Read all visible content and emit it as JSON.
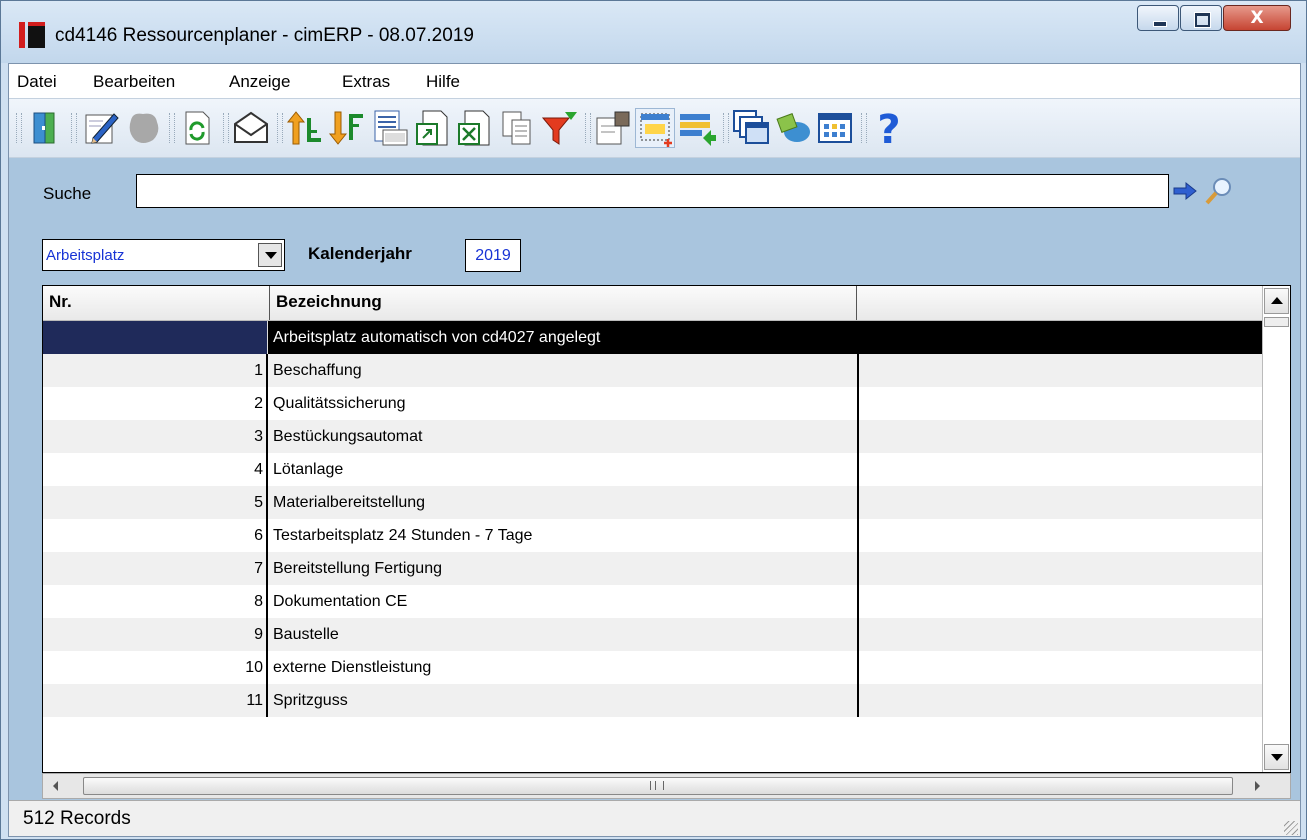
{
  "window": {
    "title": "cd4146 Ressourcenplaner - cimERP - 08.07.2019",
    "close_label": "X"
  },
  "menu": [
    "Datei",
    "Bearbeiten",
    "Anzeige",
    "Extras",
    "Hilfe"
  ],
  "toolbar": {
    "icons": [
      "exit-icon",
      "edit-icon",
      "delete-icon",
      "refresh-icon",
      "mail-icon",
      "sort-ascending-icon",
      "sort-descending-icon",
      "numbered-list-icon",
      "export-icon",
      "excel-export-icon",
      "copy-icon",
      "filter-icon",
      "properties-icon",
      "insert-icon",
      "transfer-icon",
      "windows-icon",
      "resource-icon",
      "calendar-icon",
      "help-icon"
    ],
    "help_label": "?"
  },
  "search": {
    "label": "Suche",
    "value": ""
  },
  "filter": {
    "resource_type": "Arbeitsplatz",
    "year_label": "Kalenderjahr",
    "year": "2019"
  },
  "table": {
    "columns": [
      "Nr.",
      "Bezeichnung",
      ""
    ],
    "rows": [
      {
        "nr": "",
        "name": "Arbeitsplatz automatisch von cd4027 angelegt",
        "selected": true
      },
      {
        "nr": "1",
        "name": "Beschaffung"
      },
      {
        "nr": "2",
        "name": "Qualitätssicherung"
      },
      {
        "nr": "3",
        "name": "Bestückungsautomat"
      },
      {
        "nr": "4",
        "name": "Lötanlage"
      },
      {
        "nr": "5",
        "name": "Materialbereitstellung"
      },
      {
        "nr": "6",
        "name": "Testarbeitsplatz 24 Stunden - 7 Tage"
      },
      {
        "nr": "7",
        "name": "Bereitstellung Fertigung"
      },
      {
        "nr": "8",
        "name": "Dokumentation CE"
      },
      {
        "nr": "9",
        "name": "Baustelle"
      },
      {
        "nr": "10",
        "name": "externe Dienstleistung"
      },
      {
        "nr": "11",
        "name": "Spritzguss"
      }
    ]
  },
  "status": {
    "records": "512 Records"
  },
  "colors": {
    "selection": "#000000",
    "selection_nr": "#1f2a5a",
    "field_text": "#1733d5",
    "client_bg": "#a9c5de"
  }
}
